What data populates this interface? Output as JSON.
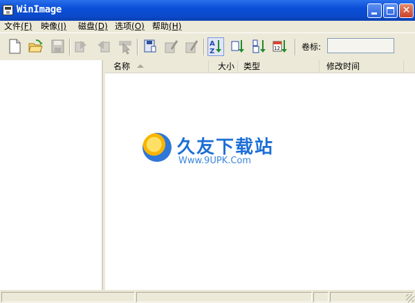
{
  "window": {
    "title": "WinImage"
  },
  "menu": [
    {
      "label": "文件",
      "key": "(F)"
    },
    {
      "label": "映像",
      "key": "(I)"
    },
    {
      "label": "磁盘",
      "key": "(D)"
    },
    {
      "label": "选项",
      "key": "(O)"
    },
    {
      "label": "帮助",
      "key": "(H)"
    }
  ],
  "toolbar": {
    "label_caption": "卷标:",
    "label_value": ""
  },
  "list": {
    "columns": {
      "name": "名称",
      "size": "大小",
      "type": "类型",
      "modified": "修改时间"
    }
  },
  "watermark": {
    "cn": "久友下载站",
    "url": "Www.9UPK.Com"
  },
  "status": [
    "",
    "",
    "",
    ""
  ]
}
